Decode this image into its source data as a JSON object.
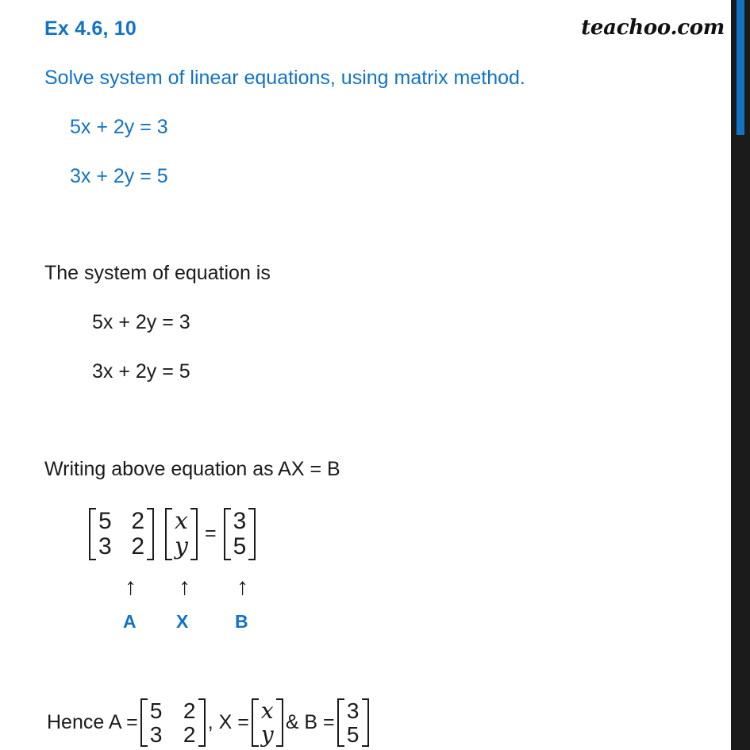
{
  "page": {
    "exercise_title": "Ex 4.6,  10",
    "brand": "teachoo.com",
    "question": "Solve system of linear equations, using matrix method.",
    "question_equations": [
      "5x + 2y = 3",
      "3x + 2y = 5"
    ],
    "system_heading": "The system of equation is",
    "system_equations": [
      "5x + 2y = 3",
      "3x + 2y = 5"
    ],
    "writing_heading": "Writing above equation as AX = B",
    "matrix_A": [
      [
        "5",
        "2"
      ],
      [
        "3",
        "2"
      ]
    ],
    "matrix_X": [
      [
        "x"
      ],
      [
        "y"
      ]
    ],
    "matrix_B": [
      [
        "3"
      ],
      [
        "5"
      ]
    ],
    "equals_sign": "=",
    "arrow_glyph": "↑",
    "labels": {
      "a": "A",
      "x": "X",
      "b": "B"
    },
    "hence": {
      "prefix": "Hence A =",
      "comma": ", X =",
      "amp": "& B ="
    }
  },
  "colors": {
    "accent_blue": "#1273c4",
    "text_dark": "#1b1b1b",
    "sidebar_dark": "#1b1b1b"
  }
}
